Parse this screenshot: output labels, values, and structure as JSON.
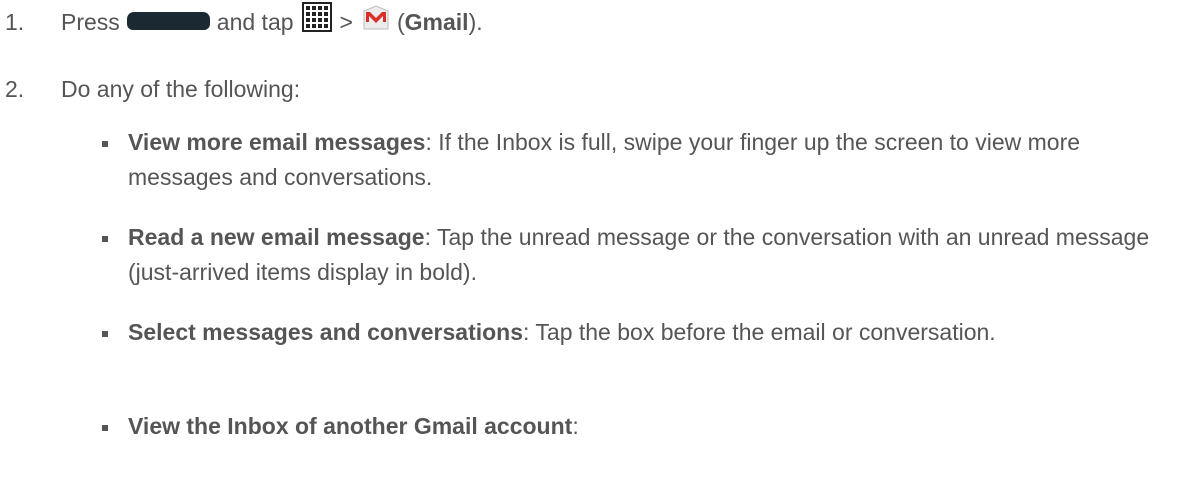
{
  "steps": [
    {
      "number": "1.",
      "press": "Press",
      "and_tap": "and tap",
      "separator": ">",
      "open_paren": "(",
      "app_name": "Gmail",
      "close_paren": ")."
    },
    {
      "number": "2.",
      "text": "Do any of the following:"
    }
  ],
  "bullets": [
    {
      "title": "View more email messages",
      "text": ": If the Inbox is full, swipe your finger up the screen to view more messages and conversations."
    },
    {
      "title": "Read a new email message",
      "text": ": Tap the unread message or the conversation with an unread message (just-arrived items display in bold)."
    },
    {
      "title": "Select messages and conversations",
      "text": ": Tap the box before the email or conversation."
    },
    {
      "title": "View the Inbox of another Gmail account",
      "text": ":"
    }
  ],
  "icons": {
    "home_key": "home-key-icon",
    "apps": "apps-grid-icon",
    "gmail": "gmail-icon"
  },
  "colors": {
    "text": "#555555",
    "home_key": "#1b2a32",
    "gmail_red": "#d93025"
  }
}
